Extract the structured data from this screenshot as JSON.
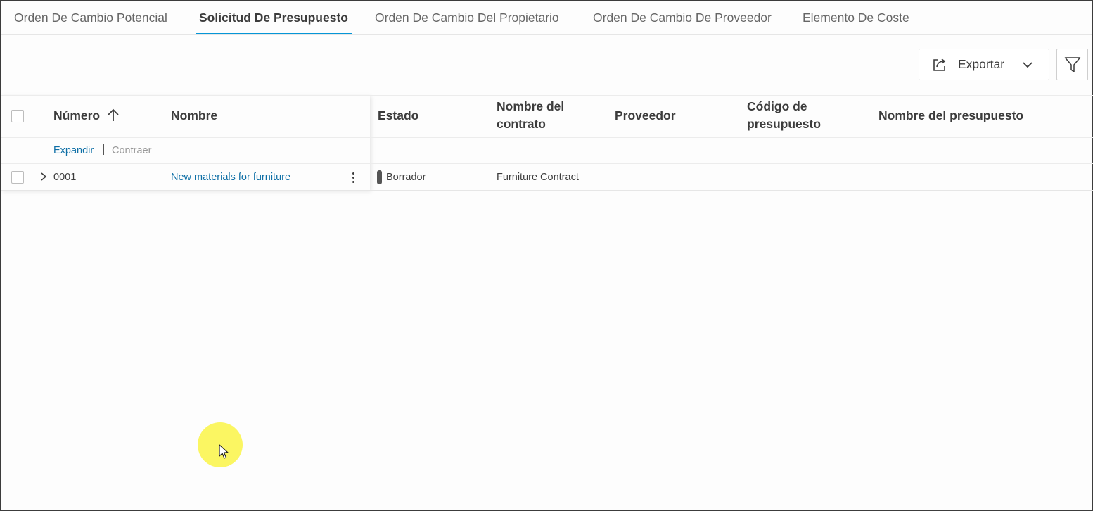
{
  "tabs": [
    {
      "label": "Orden De Cambio Potencial"
    },
    {
      "label": "Solicitud De Presupuesto"
    },
    {
      "label": "Orden De Cambio Del Propietario"
    },
    {
      "label": "Orden De Cambio De Proveedor"
    },
    {
      "label": "Elemento De Coste"
    }
  ],
  "active_tab": "Solicitud De Presupuesto",
  "toolbar": {
    "export_label": "Exportar",
    "export_icon": "share-export-icon",
    "filter_icon": "funnel-icon"
  },
  "table": {
    "columns": {
      "number": "Número",
      "name": "Nombre",
      "status": "Estado",
      "contract_name_line1": "Nombre del",
      "contract_name_line2": "contrato",
      "supplier": "Proveedor",
      "budget_code_line1": "Código de",
      "budget_code_line2": "presupuesto",
      "budget_name": "Nombre del presupuesto"
    },
    "sort": {
      "column": "Número",
      "direction": "ascending"
    },
    "expand_label": "Expandir",
    "collapse_label": "Contraer",
    "rows": [
      {
        "number": "0001",
        "name": "New materials for furniture",
        "status": "Borrador",
        "contract_name": "Furniture Contract",
        "supplier": "",
        "budget_code": "",
        "budget_name": ""
      }
    ]
  },
  "colors": {
    "accent": "#0696d7",
    "link": "#0e6fa6",
    "status_draft": "#555555",
    "cursor_highlight": "#faf546"
  }
}
